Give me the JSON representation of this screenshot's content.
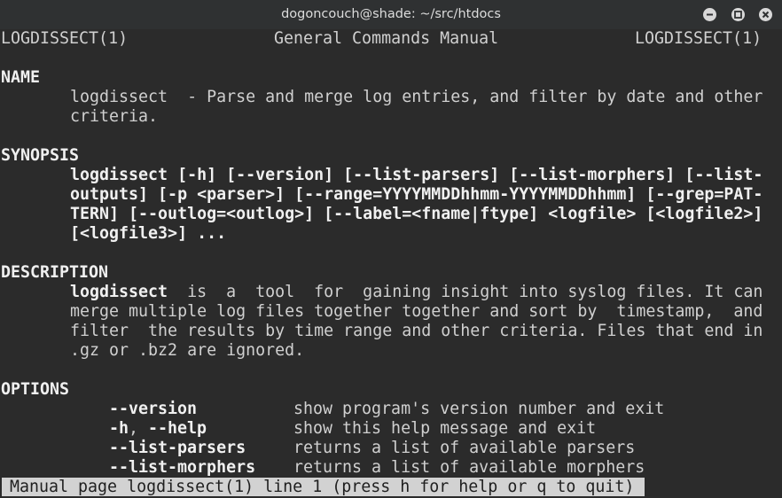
{
  "window": {
    "title": "dogoncouch@shade: ~/src/htdocs",
    "buttons": [
      "minimize-icon",
      "maximize-icon",
      "close-icon"
    ],
    "colors": {
      "titlebar": "#2f3132",
      "terminal_bg": "#2b2b2b",
      "text": "#d0d0d0",
      "status_bg": "#d2d2d2"
    }
  },
  "man": {
    "header": {
      "left": "LOGDISSECT(1)",
      "center": "General Commands Manual",
      "right": "LOGDISSECT(1)"
    },
    "name": {
      "heading": "NAME",
      "line1": "logdissect  - Parse and merge log entries, and filter by date and other",
      "line2": "criteria."
    },
    "synopsis": {
      "heading": "SYNOPSIS",
      "lines": [
        "logdissect [-h] [--version] [--list-parsers] [--list-morphers] [--list-",
        "outputs] [-p <parser>] [--range=YYYYMMDDhhmm-YYYYMMDDhhmm] [--grep=PAT-",
        "TERN] [--outlog=<outlog>] [--label=<fname|ftype] <logfile> [<logfile2>]",
        "[<logfile3>] ..."
      ]
    },
    "description": {
      "heading": "DESCRIPTION",
      "cmd": "logdissect",
      "line1_rest": "  is  a  tool  for  gaining insight into syslog files. It can",
      "line2": "merge multiple log files together together and sort by  timestamp,  and",
      "line3": "filter  the results by time range and other criteria. Files that end in",
      "line4": ".gz or .bz2 are ignored."
    },
    "options": {
      "heading": "OPTIONS",
      "items": [
        {
          "flag": "--version",
          "flag2": "",
          "desc": "show program's version number and exit"
        },
        {
          "flag": "-h",
          "flag2": "--help",
          "desc": "show this help message and exit"
        },
        {
          "flag": "--list-parsers",
          "flag2": "",
          "desc": "returns a list of available parsers"
        },
        {
          "flag": "--list-morphers",
          "flag2": "",
          "desc": "returns a list of available morphers"
        }
      ]
    }
  },
  "status": {
    "text": "Manual page logdissect(1) line 1 (press h for help or q to quit)"
  }
}
